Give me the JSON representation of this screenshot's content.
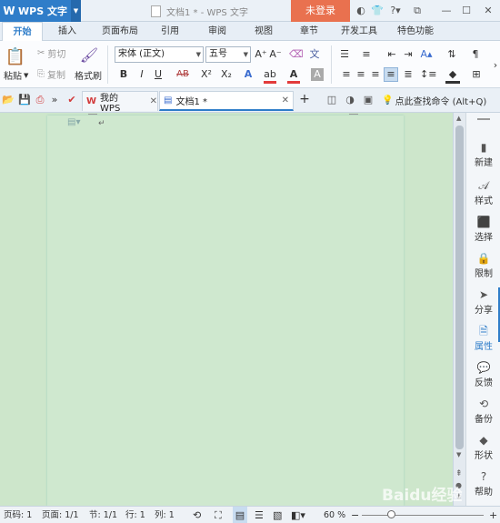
{
  "app": {
    "name": "WPS 文字",
    "logo": "W"
  },
  "document": {
    "title": "文档1 * - WPS 文字"
  },
  "login_label": "未登录",
  "ribbon_tabs": [
    "开始",
    "插入",
    "页面布局",
    "引用",
    "审阅",
    "视图",
    "章节",
    "开发工具",
    "特色功能"
  ],
  "ribbon": {
    "paste": "粘贴",
    "cut": "剪切",
    "copy": "复制",
    "format_painter": "格式刷",
    "font_name": "宋体 (正文)",
    "font_size": "五号",
    "bold": "B",
    "italic": "I",
    "underline": "U",
    "strike": "AB",
    "superscript": "X²",
    "subscript": "X₂",
    "font_color": "A",
    "highlight": "ab"
  },
  "quickbar": {
    "my_wps_tab": "我的WPS",
    "doc_tab": "文档1 *",
    "search_cmd": "点此查找命令 (Alt+Q)"
  },
  "right_panel": [
    "新建",
    "样式",
    "选择",
    "限制",
    "分享",
    "属性",
    "反馈",
    "备份",
    "形状",
    "帮助"
  ],
  "status": {
    "page_num": "页码: 1",
    "pages": "页面: 1/1",
    "section": "节: 1/1",
    "line": "行: 1",
    "column": "列: 1",
    "zoom": "60 %"
  },
  "watermark": "Baidu经验",
  "colors": {
    "accent": "#2f7dc9",
    "login": "#e9714f",
    "canvas": "#cde6cb"
  }
}
